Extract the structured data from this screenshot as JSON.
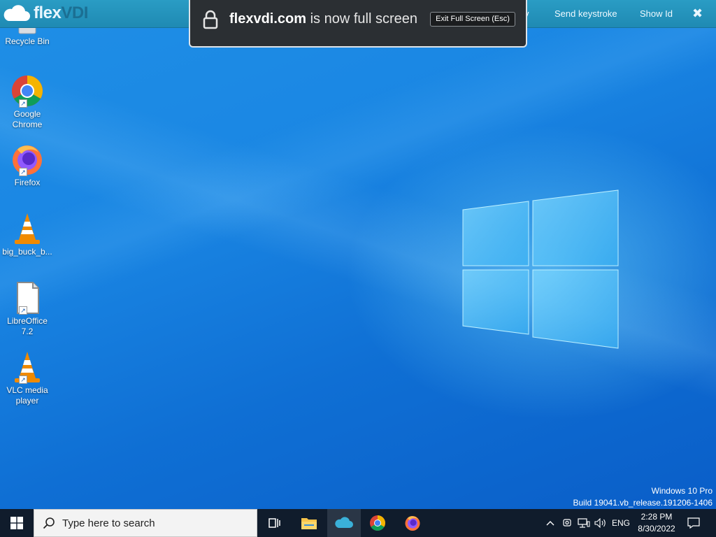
{
  "toolbar": {
    "brand": "flexVDI",
    "brand_flex": "flex",
    "brand_vdi": "VDI",
    "partial_menu": "v",
    "send_keystroke": "Send keystroke",
    "show_id": "Show Id",
    "close": "✖"
  },
  "fullscreen_notice": {
    "domain": "flexvdi.com",
    "message": " is now full screen",
    "exit_button": "Exit Full Screen (Esc)"
  },
  "desktop": {
    "icons": [
      {
        "label": "Recycle Bin",
        "icon": "recycle-bin-icon"
      },
      {
        "label": "Google Chrome",
        "icon": "chrome-icon"
      },
      {
        "label": "Firefox",
        "icon": "firefox-icon"
      },
      {
        "label": "big_buck_b...",
        "icon": "vlc-cone-icon"
      },
      {
        "label": "LibreOffice 7.2",
        "icon": "libreoffice-icon"
      },
      {
        "label": "VLC media player",
        "icon": "vlc-cone-icon"
      }
    ],
    "watermark": {
      "line1": "Windows 10 Pro",
      "line2": "Build 19041.vb_release.191206-1406"
    }
  },
  "taskbar": {
    "search_placeholder": "Type here to search",
    "apps": [
      {
        "name": "task-view",
        "icon": "task-view-icon"
      },
      {
        "name": "file-explorer",
        "icon": "folder-icon"
      },
      {
        "name": "flexvdi",
        "icon": "cloud-icon",
        "active": true
      },
      {
        "name": "chrome",
        "icon": "chrome-icon"
      },
      {
        "name": "firefox",
        "icon": "firefox-icon"
      }
    ],
    "tray": {
      "language": "ENG",
      "time": "2:28 PM",
      "date": "8/30/2022"
    }
  },
  "colors": {
    "toolbar": "#2196be",
    "taskbar": "#101c2c",
    "desktop": "#1a86e3"
  }
}
